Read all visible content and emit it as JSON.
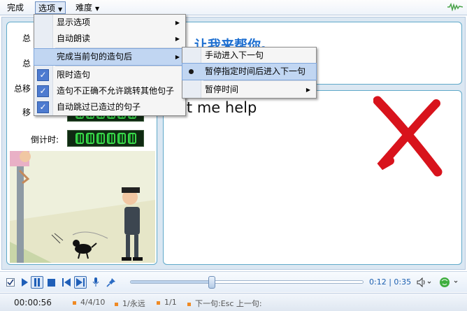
{
  "menubar": {
    "done": "完成",
    "options": "选项",
    "difficulty": "难度"
  },
  "options_menu": {
    "items": [
      {
        "label": "显示选项",
        "has_submenu": true
      },
      {
        "label": "自动朗读",
        "has_submenu": true
      },
      {
        "label": "完成当前句的造句后",
        "has_submenu": true,
        "highlighted": true
      },
      {
        "label": "限时造句",
        "checked": true
      },
      {
        "label": "造句不正确不允许跳转其他句子",
        "checked": true
      },
      {
        "label": "自动跳过已造过的句子",
        "checked": true
      }
    ]
  },
  "after_menu": {
    "items": [
      {
        "label": "手动进入下一句"
      },
      {
        "label": "暂停指定时间后进入下一句",
        "selected": true
      },
      {
        "label": "暂停时间",
        "has_submenu": true
      }
    ]
  },
  "left_panel": {
    "label1": "总",
    "label2": "总",
    "label3": "总移",
    "label4": "移",
    "countdown_label": "倒计时:"
  },
  "prompt": {
    "text": "让我来帮你。"
  },
  "sentence": {
    "text": "et me help"
  },
  "playback": {
    "current_time": "0:12",
    "total_time": "0:35",
    "progress": 0.35
  },
  "statusbar": {
    "elapsed": "00:00:56",
    "sentence_progress": "4/4/10",
    "attempts": "1/永远",
    "page": "1/1",
    "hint": "下一句:Esc 上一句:"
  },
  "colors": {
    "accent": "#1d6fd1",
    "check_blue": "#4d7bd0",
    "wrong_red": "#d8131c",
    "led_green": "#39d94a"
  }
}
